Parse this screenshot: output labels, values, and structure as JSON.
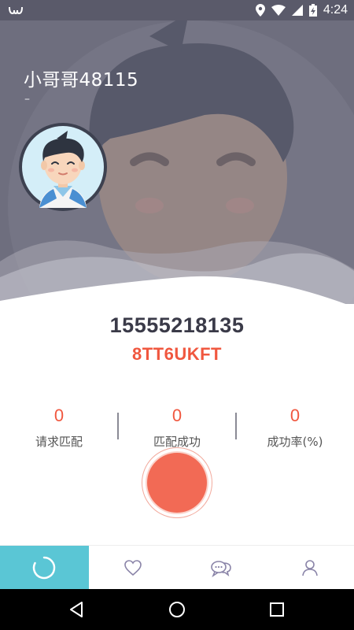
{
  "status_bar": {
    "time": "4:24",
    "icons": [
      "notification-icon",
      "location-icon",
      "wifi-icon",
      "signal-icon",
      "battery-charging-icon"
    ]
  },
  "profile": {
    "username": "小哥哥48115",
    "signature": "–",
    "phone": "15555218135",
    "invite_code": "8TT6UKFT"
  },
  "stats": [
    {
      "value": "0",
      "label": "请求匹配"
    },
    {
      "value": "0",
      "label": "匹配成功"
    },
    {
      "value": "0",
      "label": "成功率(%)"
    }
  ],
  "tabs": [
    {
      "icon": "match-loading-icon",
      "active": true
    },
    {
      "icon": "heart-icon",
      "active": false
    },
    {
      "icon": "chat-bubbles-icon",
      "active": false
    },
    {
      "icon": "user-icon",
      "active": false
    }
  ],
  "nav": [
    "back-icon",
    "home-icon",
    "recents-icon"
  ],
  "colors": {
    "accent": "#f0573f",
    "tab_active": "#5ac6d5",
    "header_bg": "#6e6e7e"
  }
}
